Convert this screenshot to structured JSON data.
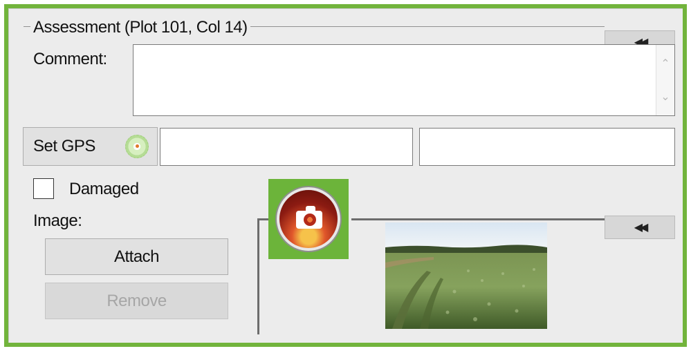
{
  "assessment": {
    "group_title": "Assessment (Plot 101, Col  14)",
    "collapse_glyph": "◀◀"
  },
  "comment": {
    "label": "Comment:",
    "value": "",
    "scroll_up": "⌃",
    "scroll_down": "⌄"
  },
  "gps": {
    "button_label": "Set GPS",
    "latitude_value": "",
    "longitude_value": ""
  },
  "damaged": {
    "label": "Damaged",
    "checked": false
  },
  "image": {
    "label": "Image:",
    "attach_label": "Attach",
    "remove_label": "Remove",
    "collapse_glyph": "◀◀"
  },
  "colors": {
    "frame_border": "#72b43c",
    "panel_bg": "#ececec",
    "camera_tile": "#6cb43a",
    "disabled_text": "#a6a6a6"
  },
  "icons": {
    "gps": "gps-target-icon",
    "camera": "camera-icon",
    "collapse": "double-chevron-left-icon",
    "scroll_up": "chevron-up-icon",
    "scroll_down": "chevron-down-icon"
  }
}
